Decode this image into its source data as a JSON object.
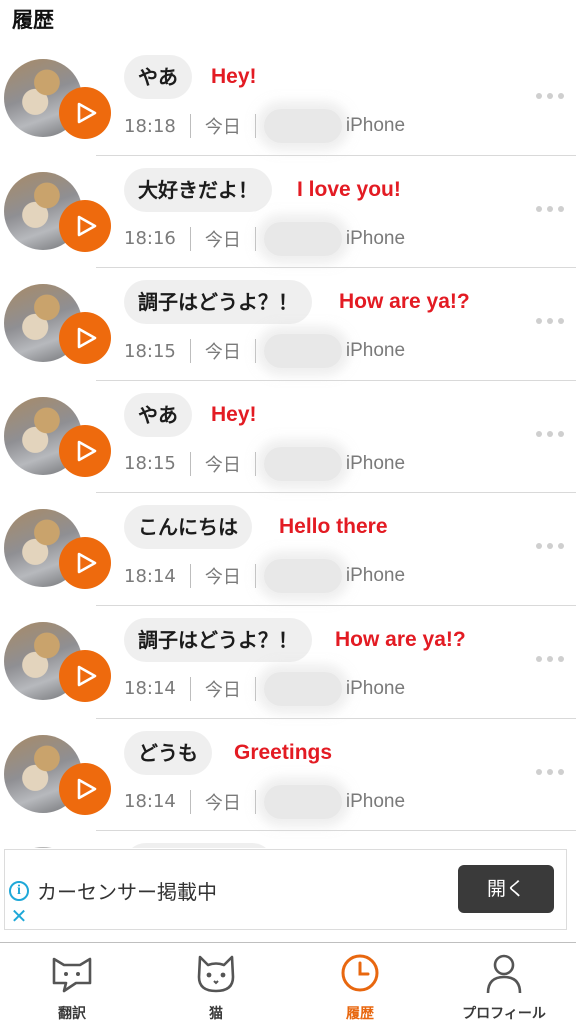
{
  "header": {
    "title": "履歴"
  },
  "history": [
    {
      "phrase": "やあ",
      "translation": "Hey!",
      "time": "18:18",
      "day": "今日",
      "device": "iPhone"
    },
    {
      "phrase": "大好きだよ！",
      "translation": "I love you!",
      "time": "18:16",
      "day": "今日",
      "device": "iPhone"
    },
    {
      "phrase": "調子はどうよ？！",
      "translation": "How are ya!?",
      "time": "18:15",
      "day": "今日",
      "device": "iPhone"
    },
    {
      "phrase": "やあ",
      "translation": "Hey!",
      "time": "18:15",
      "day": "今日",
      "device": "iPhone"
    },
    {
      "phrase": "こんにちは",
      "translation": "Hello there",
      "time": "18:14",
      "day": "今日",
      "device": "iPhone"
    },
    {
      "phrase": "調子はどうよ？！",
      "translation": "How are ya!?",
      "time": "18:14",
      "day": "今日",
      "device": "iPhone"
    },
    {
      "phrase": "どうも",
      "translation": "Greetings",
      "time": "18:14",
      "day": "今日",
      "device": "iPhone"
    }
  ],
  "ad": {
    "text": "カーセンサー掲載中",
    "button": "開く"
  },
  "tabs": [
    {
      "label": "翻訳",
      "icon": "speech-cat-icon"
    },
    {
      "label": "猫",
      "icon": "cat-face-icon"
    },
    {
      "label": "履歴",
      "icon": "clock-icon",
      "active": true
    },
    {
      "label": "プロフィール",
      "icon": "person-icon"
    }
  ],
  "colors": {
    "accent": "#ee6a0d",
    "translation": "#e31b23",
    "bubble": "#efefef"
  }
}
